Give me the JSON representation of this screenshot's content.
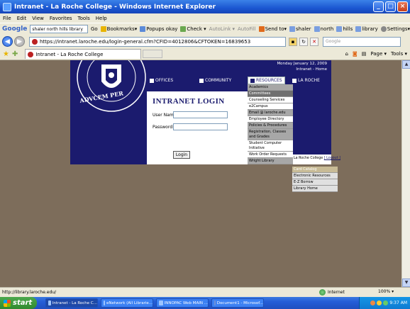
{
  "window": {
    "title": "Intranet - La Roche College - Windows Internet Explorer",
    "buttons": [
      "_",
      "□",
      "×"
    ]
  },
  "menu": [
    "File",
    "Edit",
    "View",
    "Favorites",
    "Tools",
    "Help"
  ],
  "google_toolbar": {
    "logo": "Google",
    "search_value": "shaler north hills library",
    "items": [
      "Go",
      "Bookmarks▾",
      "Popups okay",
      "Check ▾",
      "AutoLink ▾",
      "AutoFill",
      "Send to▾",
      "shaler",
      "north",
      "hills",
      "library",
      "Settings▾"
    ]
  },
  "address": {
    "url": "https://intranet.laroche.edu/login-general.cfm?CFID=4012806&CFTOKEN=16839653",
    "search_placeholder": "Google"
  },
  "tabs": {
    "active_tab": "Intranet - La Roche College",
    "commands": [
      "Page ▾",
      "Tools ▾"
    ]
  },
  "page": {
    "date": "Monday January 12, 2009",
    "home_links": "Intranet  -  Home",
    "nav": [
      {
        "label": "OFFICES"
      },
      {
        "label": "COMMUNITY"
      },
      {
        "label": "RESOURCES"
      },
      {
        "label": "LA ROCHE"
      }
    ],
    "login": {
      "title": "INTRANET LOGIN",
      "user_label": "User Name:",
      "password_label": "Password:",
      "button": "Login"
    },
    "footer": {
      "text": "La Roche College",
      "logout": "[ Logout ]"
    },
    "resources_menu": [
      "Academics",
      "Committees",
      "Counseling Services",
      "e2Campus",
      "Email @ laroche.edu",
      "Employee Directory",
      "Policies & Procedures",
      "Registration, Classes and Grades",
      "Student Computer Initiative",
      "Work Order Requests",
      "Wright Library"
    ],
    "library_menu": [
      "Card Catalog",
      "Electronic Resources",
      "E-Z Borrow",
      "Library Home"
    ]
  },
  "status": {
    "text": "http://library.laroche.edu/",
    "zone": "Internet",
    "zoom": "100%"
  },
  "taskbar": {
    "start": "start",
    "tasks": [
      "Intranet - La Roche C...",
      "eNetwork (All Librarie...",
      "INNOPAC Web MAIN ...",
      "Document1 - Microsof..."
    ],
    "clock": "9:37 AM"
  },
  "colors": {
    "navy": "#1b1b6e",
    "background": "#7d6d5b",
    "highlight": "#c8bb96"
  }
}
